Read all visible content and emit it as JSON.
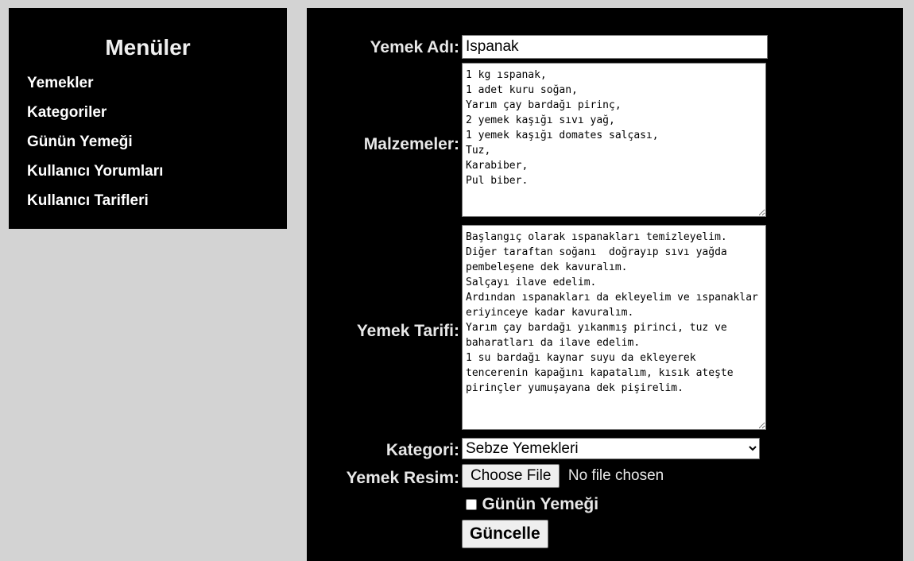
{
  "sidebar": {
    "title": "Menüler",
    "items": [
      {
        "label": "Yemekler"
      },
      {
        "label": "Kategoriler"
      },
      {
        "label": "Günün Yemeği"
      },
      {
        "label": "Kullanıcı Yorumları"
      },
      {
        "label": "Kullanıcı Tarifleri"
      }
    ]
  },
  "form": {
    "name_label": "Yemek Adı:",
    "name_value": "Ispanak",
    "ingredients_label": "Malzemeler:",
    "ingredients_value": "1 kg ıspanak,\n1 adet kuru soğan,\nYarım çay bardağı pirinç,\n2 yemek kaşığı sıvı yağ,\n1 yemek kaşığı domates salçası,\nTuz,\nKarabiber,\nPul biber.",
    "recipe_label": "Yemek Tarifi:",
    "recipe_value": "Başlangıç olarak ıspanakları temizleyelim.\nDiğer taraftan soğanı  doğrayıp sıvı yağda pembeleşene dek kavuralım.\nSalçayı ilave edelim.\nArdından ıspanakları da ekleyelim ve ıspanaklar eriyinceye kadar kavuralım.\nYarım çay bardağı yıkanmış pirinci, tuz ve baharatları da ilave edelim.\n1 su bardağı kaynar suyu da ekleyerek tencerenin kapağını kapatalım, kısık ateşte pirinçler yumuşayana dek pişirelim.",
    "category_label": "Kategori:",
    "category_selected": "Sebze Yemekleri",
    "image_label": "Yemek Resim:",
    "file_button": "Choose File",
    "file_status": "No file chosen",
    "dish_of_day_label": "Günün Yemeği",
    "submit_label": "Güncelle"
  }
}
